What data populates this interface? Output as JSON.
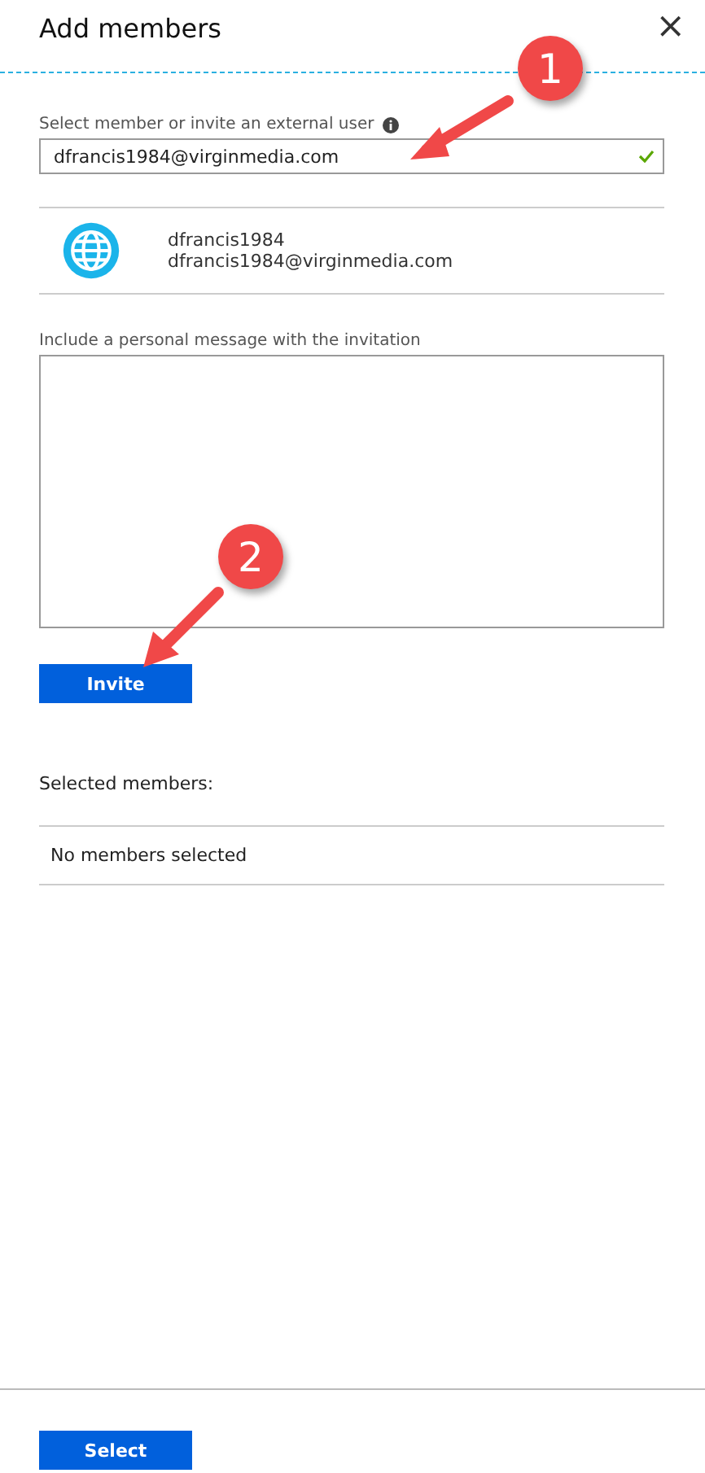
{
  "panel": {
    "title": "Add members",
    "close": "×"
  },
  "member_field": {
    "label": "Select member or invite an external user",
    "value": "dfrancis1984@virginmedia.com",
    "valid": true
  },
  "result": {
    "name": "dfrancis1984",
    "email": "dfrancis1984@virginmedia.com"
  },
  "message_field": {
    "label": "Include a personal message with the invitation"
  },
  "invite_button": "Invite",
  "selected_members": {
    "heading": "Selected members:",
    "empty_text": "No members selected"
  },
  "select_button": "Select",
  "callouts": [
    {
      "number": "1"
    },
    {
      "number": "2"
    }
  ]
}
